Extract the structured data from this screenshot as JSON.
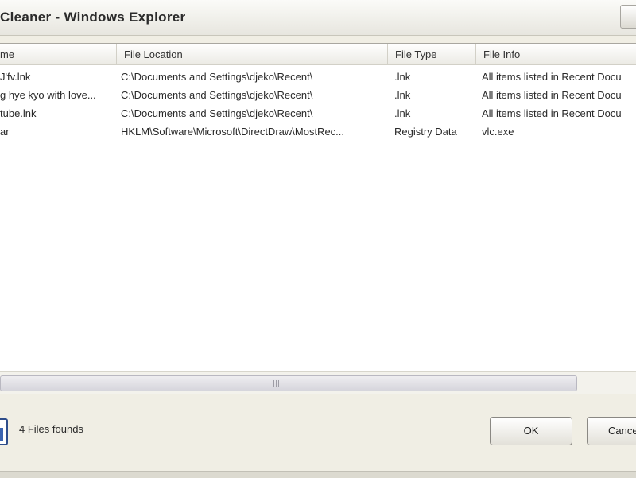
{
  "window": {
    "title": "Cleaner - Windows Explorer"
  },
  "table": {
    "columns": [
      "me",
      "File Location",
      "File Type",
      "File Info"
    ],
    "rows": [
      [
        "J'fv.lnk",
        "C:\\Documents and Settings\\djeko\\Recent\\",
        ".lnk",
        "All items listed in Recent Docu"
      ],
      [
        "g hye kyo with love...",
        "C:\\Documents and Settings\\djeko\\Recent\\",
        ".lnk",
        "All items listed in Recent Docu"
      ],
      [
        "tube.lnk",
        "C:\\Documents and Settings\\djeko\\Recent\\",
        ".lnk",
        "All items listed in Recent Docu"
      ],
      [
        "ar",
        "HKLM\\Software\\Microsoft\\DirectDraw\\MostRec...",
        "Registry Data",
        "vlc.exe"
      ]
    ]
  },
  "status": {
    "text": "4 Files founds"
  },
  "buttons": {
    "ok": "OK",
    "cancel": "Cancel"
  },
  "icons": {
    "status": "files-icon",
    "close": "close-icon"
  }
}
